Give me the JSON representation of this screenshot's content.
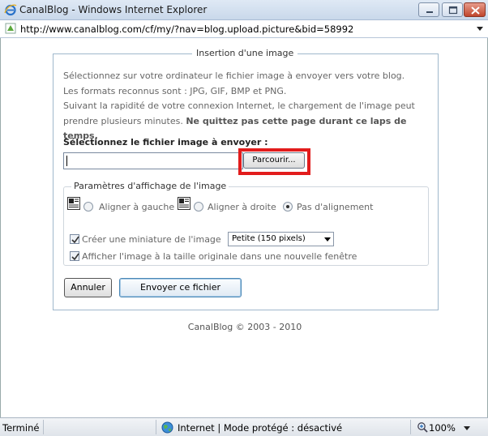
{
  "window": {
    "title": "CanalBlog - Windows Internet Explorer",
    "app_icon": "ie-icon",
    "controls": [
      "minimize-icon",
      "maximize-icon",
      "close-icon"
    ]
  },
  "address_bar": {
    "url": "http://www.canalblog.com/cf/my/?nav=blog.upload.picture&bid=58992"
  },
  "form": {
    "legend": "Insertion d'une image",
    "intro_lines": [
      "Sélectionnez sur votre ordinateur le fichier image à envoyer vers votre blog.",
      "Les formats reconnus sont : JPG, GIF, BMP et PNG.",
      "Suivant la rapidité de votre connexion Internet, le chargement de l'image peut",
      "prendre plusieurs minutes."
    ],
    "intro_bold": "Ne quittez pas cette page durant ce laps de temps.",
    "file_label": "Sélectionnez le fichier image à envoyer :",
    "file_value": "",
    "browse_label": "Parcourir...",
    "display": {
      "legend": "Paramètres d'affichage de l'image",
      "align_options": [
        {
          "label": "Aligner à gauche",
          "selected": false,
          "icon": "align-left-icon"
        },
        {
          "label": "Aligner à droite",
          "selected": false,
          "icon": "align-right-icon"
        },
        {
          "label": "Pas d'alignement",
          "selected": true
        }
      ],
      "thumbnail_label": "Créer une miniature de l'image",
      "thumbnail_checked": true,
      "thumbnail_size": "Petite (150 pixels)",
      "original_label": "Afficher l'image à la taille originale dans une nouvelle fenêtre",
      "original_checked": true
    },
    "cancel_label": "Annuler",
    "submit_label": "Envoyer ce fichier"
  },
  "footer": {
    "copyright": "CanalBlog © 2003 - 2010"
  },
  "status_bar": {
    "status": "Terminé",
    "zone": "Internet | Mode protégé : désactivé",
    "zoom": "100%"
  },
  "colors": {
    "highlight_border": "#e21c1c",
    "fieldset_border": "#9fb8cc"
  }
}
